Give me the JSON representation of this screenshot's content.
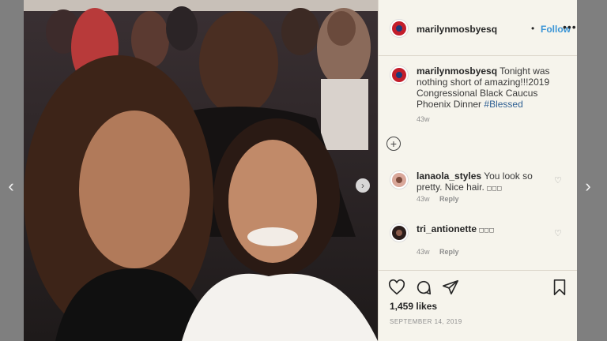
{
  "navigation": {
    "prev_icon": "chevron-left-icon",
    "next_icon": "chevron-right-icon",
    "prev_glyph": "‹",
    "next_glyph": "›",
    "carousel_next_glyph": "›"
  },
  "post": {
    "username": "marilynmosbyesq",
    "follow_label": "Follow",
    "separator": "•",
    "more_label": "•••",
    "caption": {
      "username": "marilynmosbyesq",
      "text": "Tonight was nothing short of amazing!!!2019 Congressional Black Caucus Phoenix Dinner",
      "hashtag": "#Blessed",
      "time": "43w"
    },
    "comments": [
      {
        "username": "lanaola_styles",
        "text": "You look so pretty. Nice hair. ",
        "emoji": "□□□",
        "time": "43w",
        "reply_label": "Reply"
      },
      {
        "username": "tri_antionette",
        "text": "",
        "emoji": "□□□",
        "time": "43w",
        "reply_label": "Reply"
      }
    ],
    "likes": "1,459 likes",
    "date": "SEPTEMBER 14, 2019"
  },
  "colors": {
    "accent": "#3b95d6",
    "hashtag": "#2e5f93",
    "background": "#7f7f7f",
    "panel": "#f6f4ec"
  }
}
